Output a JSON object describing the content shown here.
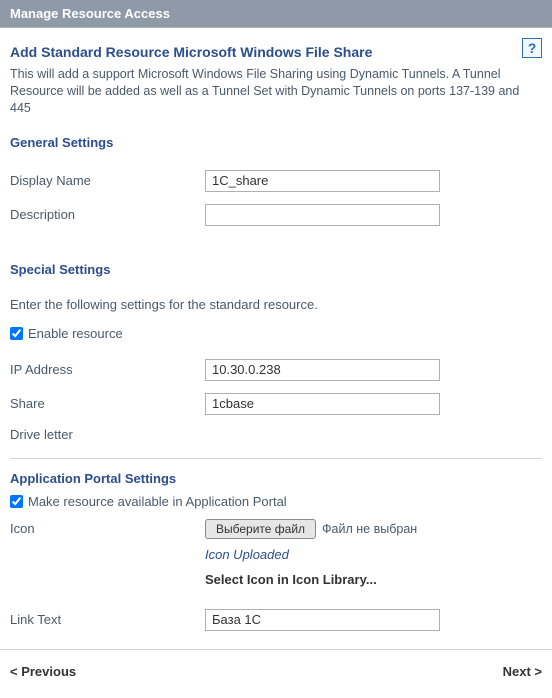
{
  "titlebar": "Manage Resource Access",
  "heading": "Add Standard Resource Microsoft Windows File Share",
  "intro": "This will add a support Microsoft Windows File Sharing using Dynamic Tunnels. A Tunnel Resource will be added as well as a Tunnel Set with Dynamic Tunnels on ports 137-139 and 445",
  "help_tooltip": "?",
  "general": {
    "heading": "General Settings",
    "display_name_label": "Display Name",
    "display_name_value": "1C_share",
    "description_label": "Description",
    "description_value": ""
  },
  "special": {
    "heading": "Special Settings",
    "subtext": "Enter the following settings for the standard resource.",
    "enable_label": "Enable resource",
    "ip_label": "IP Address",
    "ip_value": "10.30.0.238",
    "share_label": "Share",
    "share_value": "1cbase",
    "drive_label": "Drive letter"
  },
  "portal": {
    "heading": "Application Portal Settings",
    "available_label": "Make resource available in Application Portal",
    "icon_label": "Icon",
    "file_btn": "Выберите файл",
    "file_status": "Файл не выбран",
    "icon_uploaded": "Icon Uploaded",
    "select_icon": "Select Icon in Icon Library...",
    "link_text_label": "Link Text",
    "link_text_value": "База 1С"
  },
  "footer": {
    "prev": "< Previous",
    "next": "Next >"
  }
}
